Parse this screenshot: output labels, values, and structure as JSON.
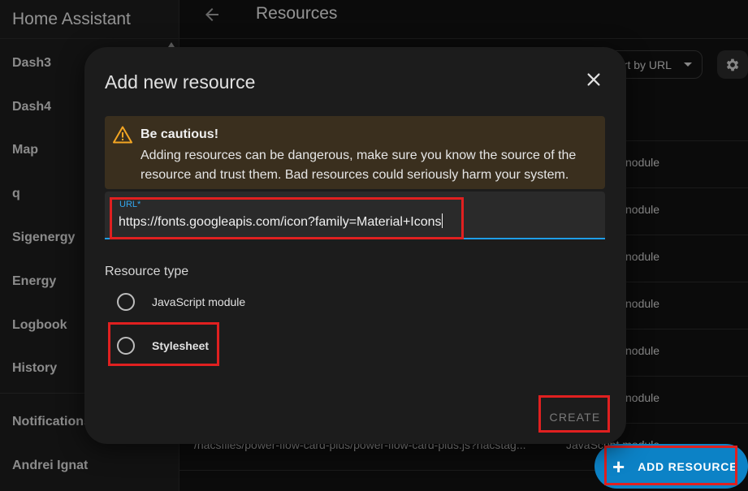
{
  "sidebar": {
    "title": "Home Assistant",
    "items": [
      {
        "label": "Dash3"
      },
      {
        "label": "Dash4"
      },
      {
        "label": "Map"
      },
      {
        "label": "q"
      },
      {
        "label": "Sigenergy"
      },
      {
        "label": "Energy"
      },
      {
        "label": "Logbook"
      },
      {
        "label": "History"
      }
    ],
    "notifications_label": "Notifications",
    "user_name": "Andrei Ignat"
  },
  "topbar": {
    "title": "Resources"
  },
  "toolbar": {
    "sort_label": "ort by URL"
  },
  "table": {
    "rows": [
      {
        "url": "",
        "type": "nodule"
      },
      {
        "url": "",
        "type": "nodule"
      },
      {
        "url": "",
        "type": "nodule"
      },
      {
        "url": "",
        "type": "nodule"
      },
      {
        "url": "",
        "type": "nodule"
      },
      {
        "url": "",
        "type": "nodule"
      },
      {
        "url": "/hacsfiles/power-flow-card-plus/power-flow-card-plus.js?hacstag...",
        "type": "JavaScript module"
      }
    ]
  },
  "fab": {
    "label": "ADD RESOURCE"
  },
  "dialog": {
    "title": "Add new resource",
    "warning": {
      "title": "Be cautious!",
      "body": "Adding resources can be dangerous, make sure you know the source of the resource and trust them. Bad resources could seriously harm your system."
    },
    "url_field": {
      "label": "URL*",
      "value": "https://fonts.googleapis.com/icon?family=Material+Icons"
    },
    "resource_type_label": "Resource type",
    "options": [
      {
        "label": "JavaScript module",
        "selected": false
      },
      {
        "label": "Stylesheet",
        "selected": false
      }
    ],
    "create_label": "CREATE"
  },
  "colors": {
    "accent": "#0c82c6",
    "focus": "#1e9ee8",
    "warning_bg": "#3a2f1e",
    "warning_icon": "#f4a623",
    "highlight": "#e02020"
  }
}
